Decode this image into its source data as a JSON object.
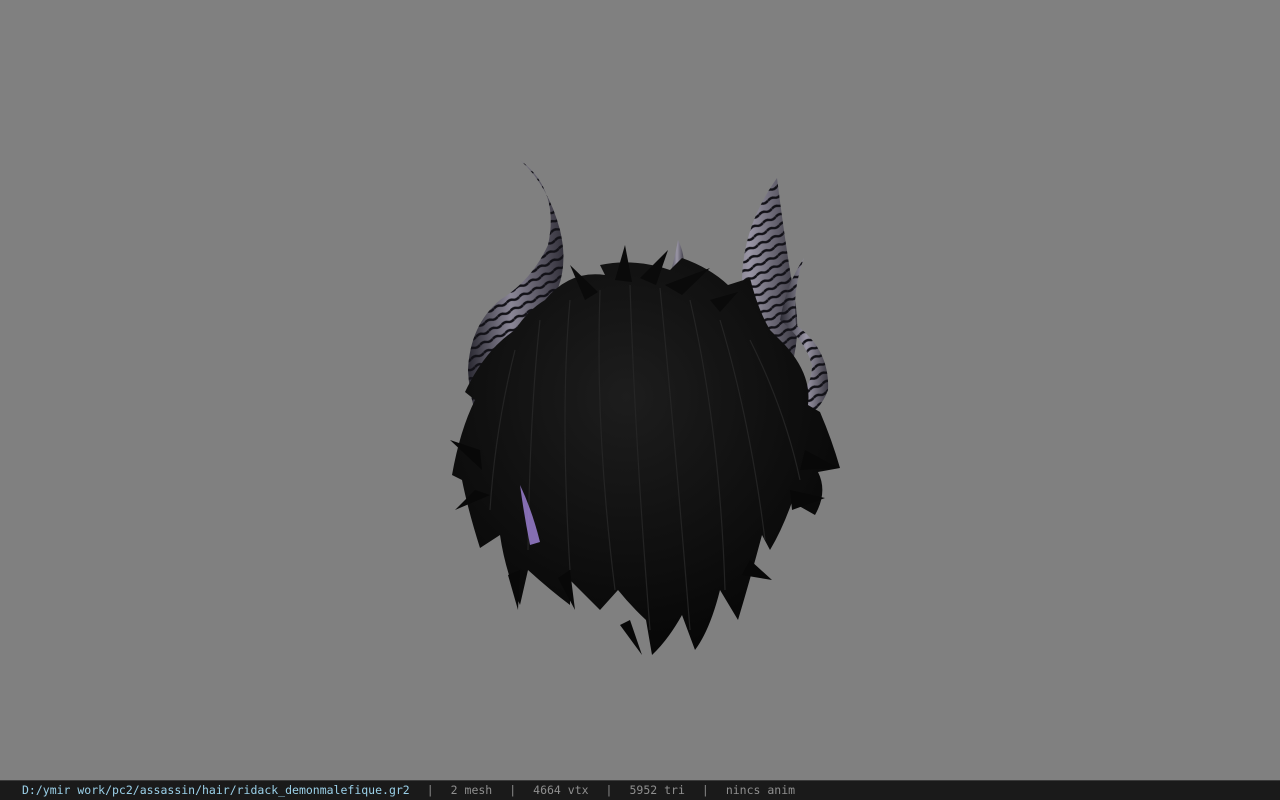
{
  "viewport": {
    "background": "#808080",
    "model_name": "demon hair with horns"
  },
  "status": {
    "file_path": "D:/ymir work/pc2/assassin/hair/ridack_demonmalefique.gr2",
    "separator": "|",
    "mesh": "2 mesh",
    "vertices": "4664 vtx",
    "triangles": "5952 tri",
    "anim": "nincs anim"
  },
  "colors": {
    "hair": "#0b0b0b",
    "horn_base": "#3e3c48",
    "horn_stripe": "#16151b",
    "horn_highlight": "#8a8696",
    "accent_purple": "#9a7fd0"
  }
}
